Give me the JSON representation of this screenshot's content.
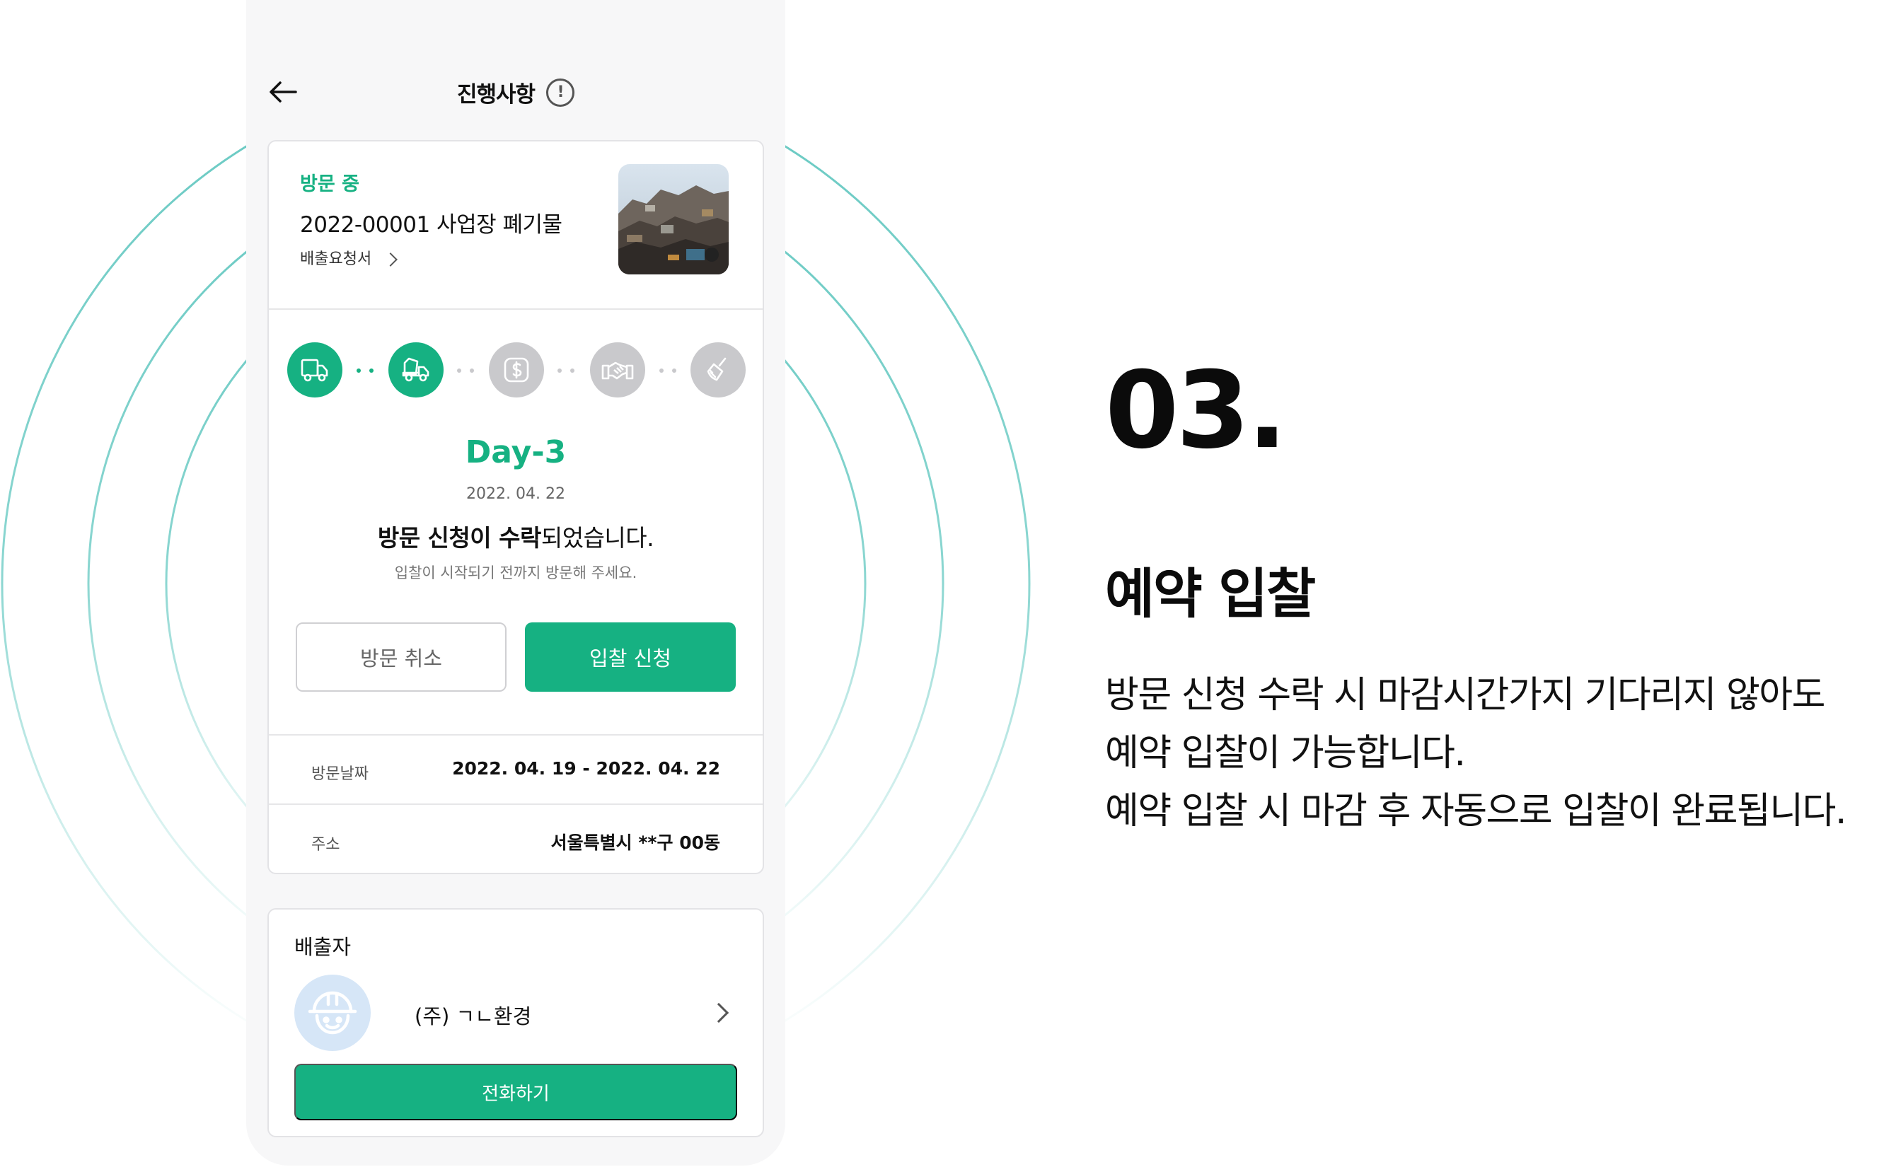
{
  "colors": {
    "accent": "#16b182",
    "inactive": "#c9c9cc",
    "ring": "#67c9c2"
  },
  "header": {
    "title": "진행사항"
  },
  "request": {
    "status": "방문 중",
    "title": "2022-00001 사업장 폐기물",
    "doc_link": "배출요청서"
  },
  "progress": {
    "steps": [
      {
        "icon": "truck-icon",
        "active": true
      },
      {
        "icon": "truck-bin-icon",
        "active": true
      },
      {
        "icon": "dollar-coin-icon",
        "active": false
      },
      {
        "icon": "handshake-icon",
        "active": false
      },
      {
        "icon": "broom-icon",
        "active": false
      }
    ],
    "day": "Day-3",
    "date": "2022. 04. 22",
    "message_bold_1": "방문 신청이 수락",
    "message_rest": "되었습니다.",
    "sub_message": "입찰이 시작되기 전까지 방문해 주세요."
  },
  "actions": {
    "cancel_label": "방문 취소",
    "bid_label": "입찰 신청"
  },
  "details": {
    "visit_date_label": "방문날짜",
    "visit_date_value": "2022. 04. 19 - 2022. 04. 22",
    "address_label": "주소",
    "address_value": "서울특별시 **구 00동"
  },
  "discharger": {
    "title": "배출자",
    "company": "(주) ㄱㄴ환경",
    "call_label": "전화하기"
  },
  "feature": {
    "step_number": "03.",
    "heading": "예약 입찰",
    "lines": [
      "방문 신청 수락 시 마감시간가지 기다리지 않아도",
      "예약 입찰이 가능합니다.",
      "예약 입찰 시 마감 후 자동으로 입찰이 완료됩니다."
    ]
  }
}
